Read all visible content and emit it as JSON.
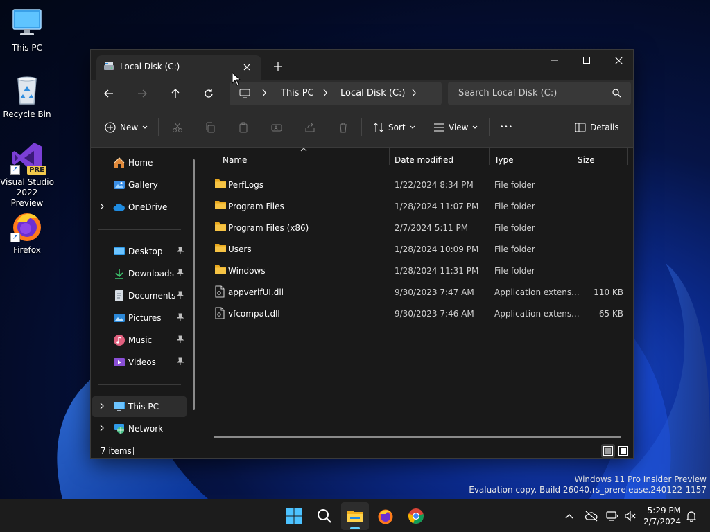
{
  "desktop": {
    "icons": [
      {
        "label": "This PC"
      },
      {
        "label": "Recycle Bin"
      },
      {
        "label_line1": "Visual Studio",
        "label_line2": "2022 Preview",
        "badge": "PRE"
      },
      {
        "label": "Firefox"
      }
    ],
    "watermark": {
      "line1": "Windows 11 Pro Insider Preview",
      "line2": "Evaluation copy. Build 26040.rs_prerelease.240122-1157"
    }
  },
  "explorer": {
    "tab": {
      "title": "Local Disk (C:)",
      "close_icon": "close-icon"
    },
    "new_tab_icon": "plus-icon",
    "caption": {
      "minimize": "minimize-icon",
      "maximize": "maximize-icon",
      "close": "close-icon"
    },
    "nav": {
      "back": "arrow-left-icon",
      "forward": "arrow-right-icon",
      "up": "arrow-up-icon",
      "refresh": "refresh-icon"
    },
    "breadcrumb": [
      "This PC",
      "Local Disk (C:)"
    ],
    "search": {
      "placeholder": "Search Local Disk (C:)"
    },
    "commands": {
      "new": "New",
      "sort": "Sort",
      "view": "View",
      "details": "Details",
      "more": "•••"
    },
    "navpane": {
      "quick": [
        {
          "label": "Home",
          "icon": "home-icon"
        },
        {
          "label": "Gallery",
          "icon": "gallery-icon"
        },
        {
          "label": "OneDrive",
          "icon": "cloud-icon"
        }
      ],
      "pinned": [
        {
          "label": "Desktop",
          "icon": "desktop-icon"
        },
        {
          "label": "Downloads",
          "icon": "download-icon"
        },
        {
          "label": "Documents",
          "icon": "document-icon"
        },
        {
          "label": "Pictures",
          "icon": "picture-icon"
        },
        {
          "label": "Music",
          "icon": "music-icon"
        },
        {
          "label": "Videos",
          "icon": "video-icon"
        }
      ],
      "bottom": [
        {
          "label": "This PC",
          "icon": "computer-icon",
          "selected": true
        },
        {
          "label": "Network",
          "icon": "network-icon"
        }
      ]
    },
    "columns": {
      "name": "Name",
      "date": "Date modified",
      "type": "Type",
      "size": "Size"
    },
    "files": [
      {
        "name": "PerfLogs",
        "date": "1/22/2024 8:34 PM",
        "type": "File folder",
        "size": "",
        "kind": "folder"
      },
      {
        "name": "Program Files",
        "date": "1/28/2024 11:07 PM",
        "type": "File folder",
        "size": "",
        "kind": "folder"
      },
      {
        "name": "Program Files (x86)",
        "date": "2/7/2024 5:11 PM",
        "type": "File folder",
        "size": "",
        "kind": "folder"
      },
      {
        "name": "Users",
        "date": "1/28/2024 10:09 PM",
        "type": "File folder",
        "size": "",
        "kind": "folder"
      },
      {
        "name": "Windows",
        "date": "1/28/2024 11:31 PM",
        "type": "File folder",
        "size": "",
        "kind": "folder"
      },
      {
        "name": "appverifUI.dll",
        "date": "9/30/2023 7:47 AM",
        "type": "Application extens...",
        "size": "110 KB",
        "kind": "file"
      },
      {
        "name": "vfcompat.dll",
        "date": "9/30/2023 7:46 AM",
        "type": "Application extens...",
        "size": "65 KB",
        "kind": "file"
      }
    ],
    "status": {
      "count": "7 items"
    }
  },
  "taskbar": {
    "apps": [
      "windows-start-icon",
      "search-icon",
      "file-explorer-icon",
      "firefox-icon",
      "chrome-icon"
    ],
    "tray": [
      "chevron-up-icon",
      "cloud-off-icon",
      "network-icon",
      "volume-mute-icon"
    ],
    "clock": {
      "time": "5:29 PM",
      "date": "2/7/2024"
    },
    "notification_icon": "bell-icon"
  },
  "colors": {
    "accent": "#60cdff",
    "folder": "#f6c344",
    "window_bg": "#191919",
    "toolbar_bg": "#2c2c2c"
  }
}
